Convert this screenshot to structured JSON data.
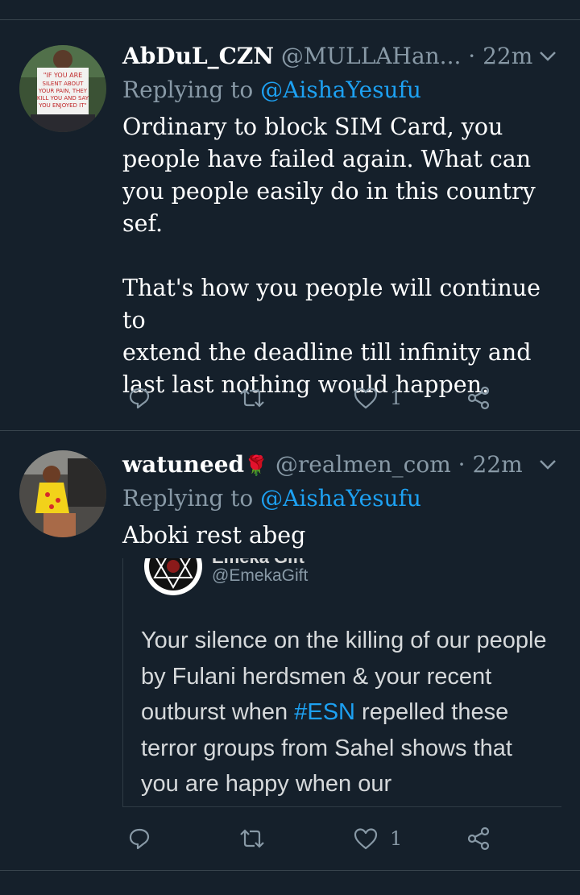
{
  "tweets": [
    {
      "display_name": "AbDuL_CZN",
      "handle": "@MULLAHan...",
      "dot": "·",
      "time": "22m",
      "reply_prefix": "Replying to ",
      "reply_to": "@AishaYesufu",
      "text": "Ordinary to block SIM Card, you\npeople have failed again. What can\nyou people easily do in this country\nsef.\n\nThat's how you people will continue to\nextend the deadline till infinity and\nlast last nothing would happen.",
      "like_count": "1",
      "avatar_sign_text": "IF YOU ARE SILENT ABOUT YOUR PAIN, THEY KILL YOU AND SAY YOU ENJOYED IT"
    },
    {
      "display_name": "watuneed",
      "name_emoji": "🌹",
      "handle": "@realmen_com",
      "dot": "·",
      "time": "22m",
      "reply_prefix": "Replying to ",
      "reply_to": "@AishaYesufu",
      "text": "Aboki rest abeg",
      "like_count": "1",
      "embedded": {
        "name_partial": "Emeka Gift",
        "handle": "@EmekaGift",
        "text_before": "Your silence on the killing of our people by Fulani herdsmen & your recent outburst when ",
        "hashtag": "#ESN",
        "text_after": " repelled these terror groups from Sahel shows that you are happy when our"
      }
    }
  ],
  "icons": [
    "reply-icon",
    "retweet-icon",
    "like-icon",
    "share-icon",
    "chevron-down-icon"
  ],
  "colors": {
    "background": "#15202b",
    "secondary_text": "#8899a6",
    "accent": "#1da1f2",
    "divider": "#38444d"
  }
}
